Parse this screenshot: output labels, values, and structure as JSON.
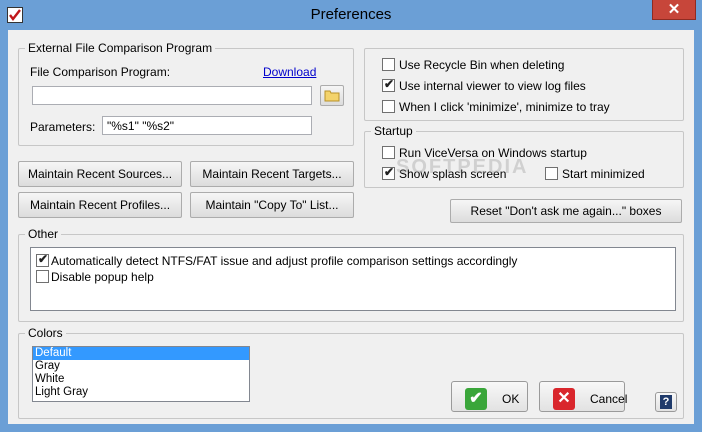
{
  "window": {
    "title": "Preferences",
    "close_glyph": "✕",
    "app_icon": "checkbox-icon"
  },
  "external": {
    "legend": "External File Comparison Program",
    "program_label": "File Comparison Program:",
    "download_link": "Download",
    "program_value": "",
    "parameters_label": "Parameters:",
    "parameters_value": "\"%s1\" \"%s2\"",
    "browse_icon": "folder-icon"
  },
  "maintain_buttons": {
    "recent_sources": "Maintain Recent Sources...",
    "recent_targets": "Maintain Recent Targets...",
    "recent_profiles": "Maintain Recent Profiles...",
    "copy_to_list": "Maintain \"Copy To\" List..."
  },
  "general_options": [
    {
      "label": "Use Recycle Bin when deleting",
      "checked": false
    },
    {
      "label": "Use internal viewer to view log files",
      "checked": true
    },
    {
      "label": "When I click 'minimize', minimize to tray",
      "checked": false
    }
  ],
  "startup": {
    "legend": "Startup",
    "run_on_startup": {
      "label": "Run ViceVersa on Windows startup",
      "checked": false
    },
    "show_splash": {
      "label": "Show splash screen",
      "checked": true
    },
    "start_minimized": {
      "label": "Start minimized",
      "checked": false
    }
  },
  "reset_button": "Reset \"Don't ask me again...\" boxes",
  "other": {
    "legend": "Other",
    "items": [
      {
        "label": "Automatically detect NTFS/FAT issue and adjust profile comparison settings accordingly",
        "checked": true
      },
      {
        "label": "Disable popup help",
        "checked": false
      }
    ]
  },
  "colors": {
    "legend": "Colors",
    "options": [
      "Default",
      "Gray",
      "White",
      "Light Gray"
    ],
    "selected": "Default"
  },
  "dialog_buttons": {
    "ok": "OK",
    "cancel": "Cancel",
    "help_glyph": "?"
  },
  "watermark": "SOFTPEDIA",
  "check_glyph": "✔"
}
